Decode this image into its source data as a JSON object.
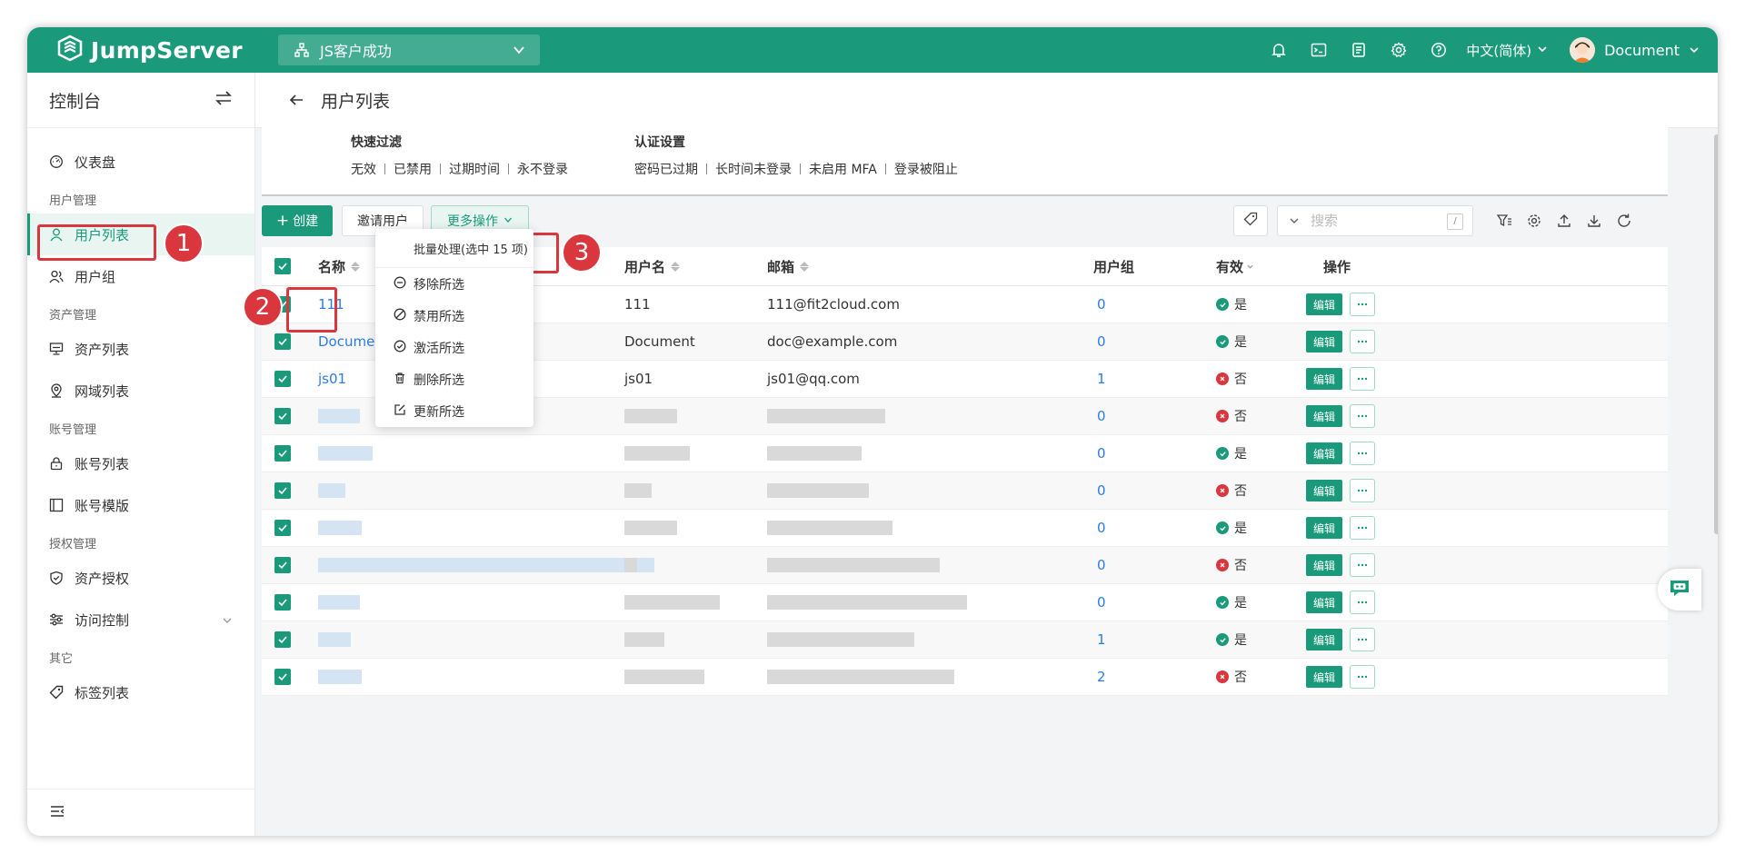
{
  "app": {
    "name": "JumpServer"
  },
  "org": {
    "selected": "JS客户成功"
  },
  "topbar": {
    "language": "中文(简体)",
    "username": "Document"
  },
  "sidebar": {
    "title": "控制台",
    "items": [
      {
        "label": "仪表盘"
      },
      {
        "group": "用户管理"
      },
      {
        "label": "用户列表"
      },
      {
        "label": "用户组"
      },
      {
        "group": "资产管理"
      },
      {
        "label": "资产列表"
      },
      {
        "label": "网域列表"
      },
      {
        "group": "账号管理"
      },
      {
        "label": "账号列表"
      },
      {
        "label": "账号模版"
      },
      {
        "group": "授权管理"
      },
      {
        "label": "资产授权"
      },
      {
        "label": "访问控制"
      },
      {
        "group": "其它"
      },
      {
        "label": "标签列表"
      }
    ]
  },
  "page": {
    "title": "用户列表"
  },
  "quick_filter": {
    "title": "快速过滤",
    "items": [
      "无效",
      "已禁用",
      "过期时间",
      "永不登录"
    ]
  },
  "auth_settings": {
    "title": "认证设置",
    "items": [
      "密码已过期",
      "长时间未登录",
      "未启用 MFA",
      "登录被阻止"
    ]
  },
  "toolbar": {
    "create_label": "创建",
    "invite_label": "邀请用户",
    "more_label": "更多操作",
    "search_placeholder": "搜索",
    "search_shortcut": "/"
  },
  "annotations": [
    "1",
    "2",
    "3"
  ],
  "table": {
    "headers": {
      "name": "名称",
      "username": "用户名",
      "email": "邮箱",
      "groups": "用户组",
      "valid": "有效",
      "actions": "操作"
    },
    "edit_label": "编辑",
    "rows": [
      {
        "name": "111",
        "username": "111",
        "email": "111@fit2cloud.com",
        "groups": "0",
        "valid": "是"
      },
      {
        "name": "Document",
        "username": "Document",
        "email": "doc@example.com",
        "groups": "0",
        "valid": "是"
      },
      {
        "name": "js01",
        "username": "js01",
        "email": "js01@qq.com",
        "groups": "1",
        "valid": "否"
      },
      {
        "name": "",
        "username": "",
        "email": "",
        "groups": "0",
        "valid": "否"
      },
      {
        "name": "",
        "username": "",
        "email": "",
        "groups": "0",
        "valid": "是"
      },
      {
        "name": "",
        "username": "",
        "email": "",
        "groups": "0",
        "valid": "否"
      },
      {
        "name": "",
        "username": "",
        "email": "",
        "groups": "0",
        "valid": "是"
      },
      {
        "name": "",
        "username": "",
        "email": "",
        "groups": "0",
        "valid": "否"
      },
      {
        "name": "",
        "username": "",
        "email": "",
        "groups": "0",
        "valid": "是"
      },
      {
        "name": "",
        "username": "",
        "email": "",
        "groups": "1",
        "valid": "是"
      },
      {
        "name": "",
        "username": "",
        "email": "",
        "groups": "2",
        "valid": "否"
      }
    ]
  },
  "dropdown": {
    "header": "批量处理(选中 15 项)",
    "items": [
      "移除所选",
      "禁用所选",
      "激活所选",
      "删除所选",
      "更新所选"
    ]
  },
  "colors": {
    "brand": "#1a9a7a",
    "link": "#2c7be5",
    "danger": "#d9363e"
  }
}
